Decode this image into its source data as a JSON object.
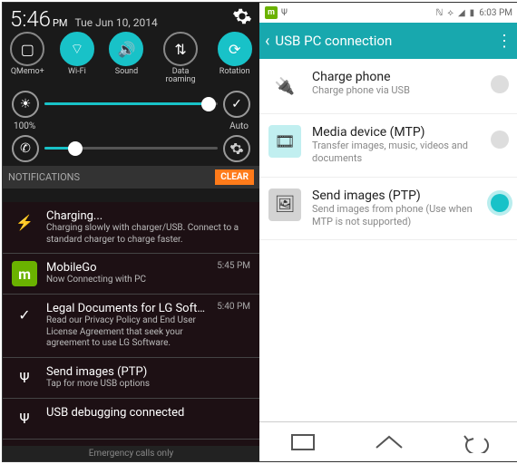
{
  "left": {
    "status": {
      "time": "5:46",
      "ampm": "PM",
      "date": "Tue Jun 10, 2014"
    },
    "toggles": [
      {
        "name": "qmemo",
        "label": "QMemo+",
        "on": false
      },
      {
        "name": "wifi",
        "label": "Wi-Fi",
        "on": true
      },
      {
        "name": "sound",
        "label": "Sound",
        "on": true
      },
      {
        "name": "roaming",
        "label": "Data roaming",
        "on": false
      },
      {
        "name": "rotation",
        "label": "Rotation",
        "on": true
      }
    ],
    "brightness": {
      "percent_label": "100%",
      "auto_label": "Auto",
      "pct": 95
    },
    "ringer": {
      "pct": 18
    },
    "notifications_label": "NOTIFICATIONS",
    "clear_label": "CLEAR",
    "notifs": [
      {
        "icon": "charging",
        "title": "Charging...",
        "desc": "Charging slowly with charger/USB. Connect to a standard charger to charge faster.",
        "time": ""
      },
      {
        "icon": "mobilego",
        "title": "MobileGo",
        "desc": "Now Connecting with PC",
        "time": "5:45 PM"
      },
      {
        "icon": "check",
        "title": "Legal Documents for LG Software",
        "desc": "Read our Privacy Policy and End User License Agreement that seek your agreement to use LG Software.",
        "time": "5:40 PM"
      },
      {
        "icon": "usb",
        "title": "Send images (PTP)",
        "desc": "Tap for more USB options",
        "time": ""
      },
      {
        "icon": "usb",
        "title": "USB debugging connected",
        "desc": "",
        "time": ""
      }
    ],
    "emergency": "Emergency calls only"
  },
  "right": {
    "status_time": "6:03 PM",
    "header_title": "USB PC connection",
    "options": [
      {
        "key": "charge",
        "title": "Charge phone",
        "desc": "Charge phone via USB",
        "selected": false,
        "color": "#444"
      },
      {
        "key": "mtp",
        "title": "Media device (MTP)",
        "desc": "Transfer images, music, videos and documents",
        "selected": false,
        "color": "#18c2c8"
      },
      {
        "key": "ptp",
        "title": "Send images (PTP)",
        "desc": "Send images from phone (Use when MTP is not supported)",
        "selected": true,
        "color": "#5a5a5a"
      }
    ]
  }
}
